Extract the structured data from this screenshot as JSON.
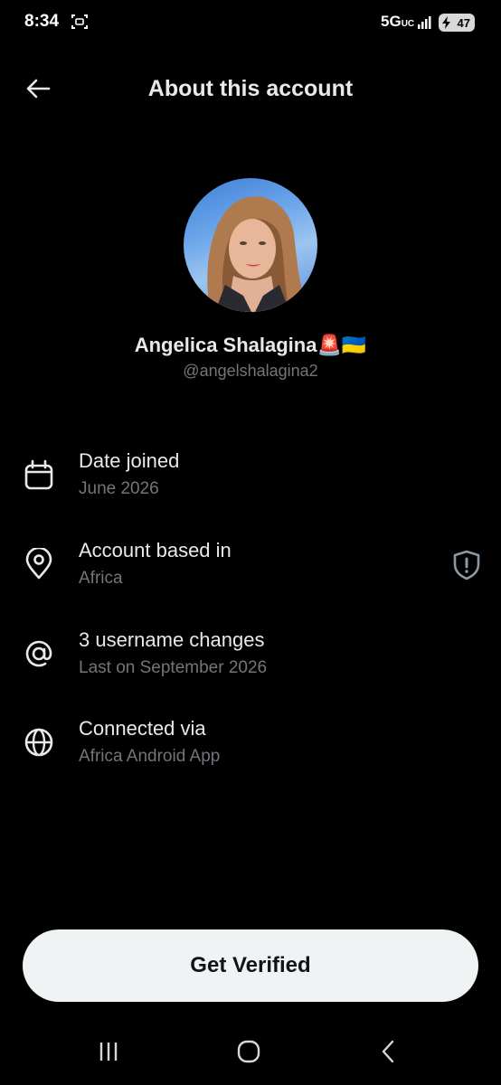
{
  "status_bar": {
    "time": "8:34",
    "network": "5G",
    "network_sub": "UC",
    "battery": "47"
  },
  "header": {
    "title": "About this account"
  },
  "profile": {
    "name": "Angelica Shalagina🚨🇺🇦",
    "handle": "@angelshalagina2"
  },
  "info_rows": [
    {
      "icon": "calendar-icon",
      "title": "Date joined",
      "subtitle": "June 2026"
    },
    {
      "icon": "location-pin-icon",
      "title": "Account based in",
      "subtitle": "Africa"
    },
    {
      "icon": "at-sign-icon",
      "title": "3 username changes",
      "subtitle": "Last on September 2026"
    },
    {
      "icon": "globe-icon",
      "title": "Connected via",
      "subtitle": "Africa Android App"
    }
  ],
  "verify_button": {
    "label": "Get Verified"
  },
  "colors": {
    "background": "#000000",
    "primary_text": "#e7e9ea",
    "secondary_text": "#71767b",
    "button_bg": "#eff3f4"
  }
}
